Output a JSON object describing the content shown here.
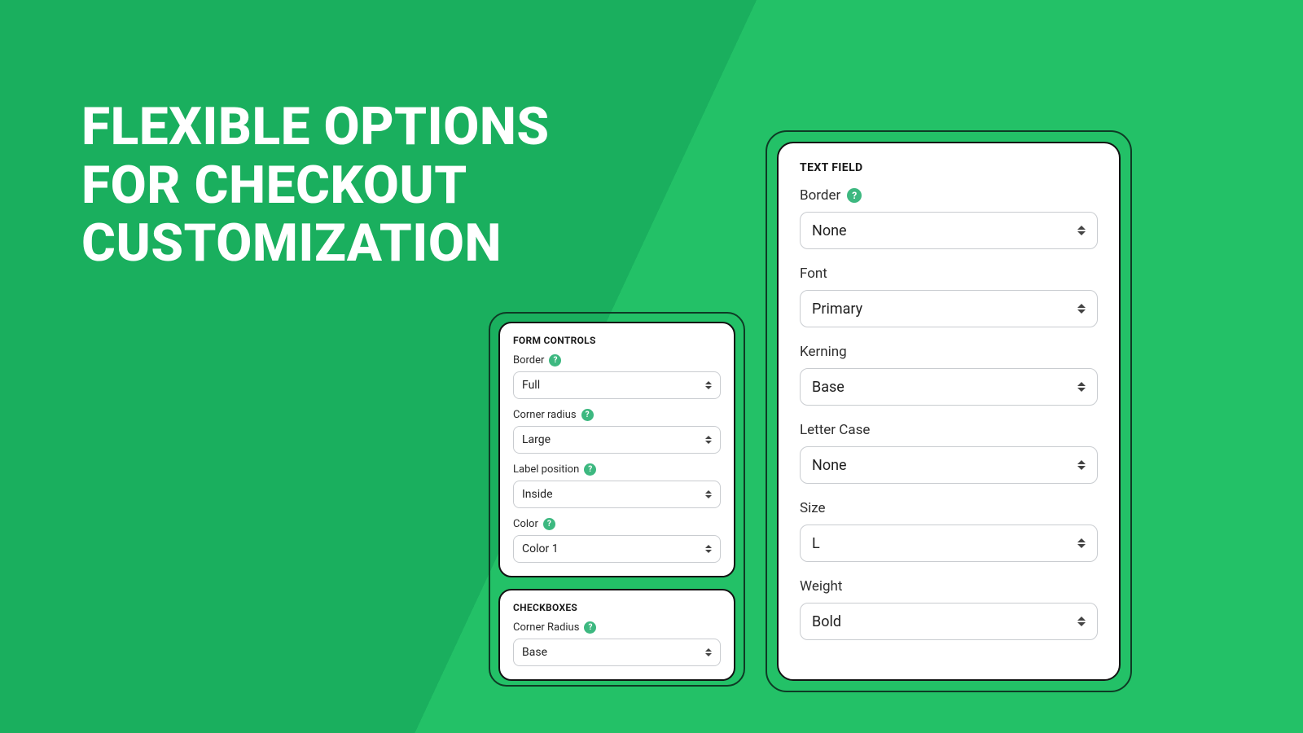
{
  "headline": {
    "line1": "Flexible options",
    "line2": "for checkout",
    "line3": "customization"
  },
  "form_controls": {
    "title": "FORM CONTROLS",
    "border": {
      "label": "Border",
      "value": "Full",
      "help": true
    },
    "corner_radius": {
      "label": "Corner radius",
      "value": "Large",
      "help": true
    },
    "label_position": {
      "label": "Label position",
      "value": "Inside",
      "help": true
    },
    "color": {
      "label": "Color",
      "value": "Color 1",
      "help": true
    }
  },
  "checkboxes": {
    "title": "CHECKBOXES",
    "corner_radius": {
      "label": "Corner Radius",
      "value": "Base",
      "help": true
    }
  },
  "text_field": {
    "title": "TEXT FIELD",
    "border": {
      "label": "Border",
      "value": "None",
      "help": true
    },
    "font": {
      "label": "Font",
      "value": "Primary",
      "help": false
    },
    "kerning": {
      "label": "Kerning",
      "value": "Base",
      "help": false
    },
    "letter_case": {
      "label": "Letter Case",
      "value": "None",
      "help": false
    },
    "size": {
      "label": "Size",
      "value": "L",
      "help": false
    },
    "weight": {
      "label": "Weight",
      "value": "Bold",
      "help": false
    }
  }
}
